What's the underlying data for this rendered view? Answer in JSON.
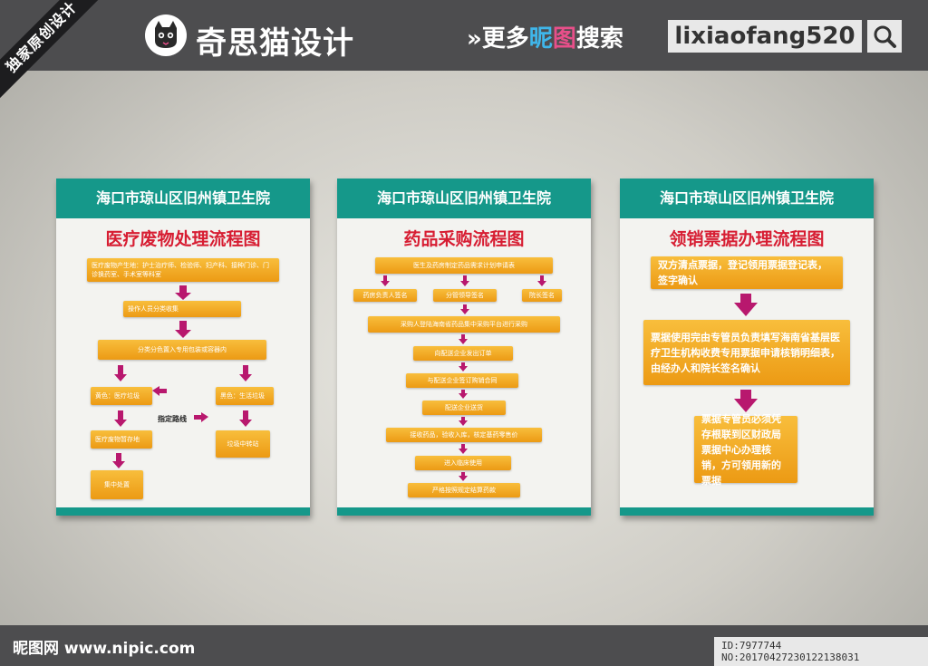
{
  "header": {
    "ribbon": "独家原创设计",
    "logo_text": "奇思猫设计",
    "more_prefix": "»更多",
    "more_hl1": "昵",
    "more_hl2": "图",
    "more_suffix": "搜索",
    "search_term": "lixiaofang520"
  },
  "footer": {
    "site": "昵图网 www.nipic.com",
    "id_info": "ID:7977744 NO:20170427230122138031"
  },
  "panels": [
    {
      "header": "海口市琼山区旧州镇卫生院",
      "title": "医疗废物处理流程图",
      "boxes": {
        "b1": "医疗废物产生地：护士治疗师、检验师、妇产科、接种门诊、门诊换药室、手术室等科室",
        "b2": "操作人员分类收集",
        "b3": "分类分色置入专用包装或容器内",
        "b4": "黄色：医疗垃圾",
        "b5": "黑色：生活垃圾",
        "b6": "医疗废物暂存地",
        "b7": "垃圾中转站",
        "b8": "集中处置"
      },
      "route_label": "指定路线"
    },
    {
      "header": "海口市琼山区旧州镇卫生院",
      "title": "药品采购流程图",
      "boxes": {
        "b1": "医生及药房制定药品需求计划申请表",
        "b2": "药房负责人签名",
        "b3": "分管领导签名",
        "b4": "院长签名",
        "b5": "采购人登陆海南省药品集中采购平台进行采购",
        "b6": "向配送企业发出订单",
        "b7": "与配送企业签订购销合同",
        "b8": "配送企业送货",
        "b9": "接收药品，验收入库，核定基药零售价",
        "b10": "进入临床使用",
        "b11": "严格按照规定结算药款"
      }
    },
    {
      "header": "海口市琼山区旧州镇卫生院",
      "title": "领销票据办理流程图",
      "boxes": {
        "b1": "双方清点票据，登记领用票据登记表，签字确认",
        "b2": "票据使用完由专管员负责填写海南省基层医疗卫生机构收费专用票据申请核销明细表，由经办人和院长签名确认",
        "b3": "票据专管员必须凭存根联到区财政局票据中心办理核销，方可领用新的票据"
      }
    }
  ],
  "colors": {
    "teal": "#15988a",
    "title_red": "#d71d32",
    "box_orange": "#f0a31e",
    "arrow_magenta": "#b8186e"
  }
}
